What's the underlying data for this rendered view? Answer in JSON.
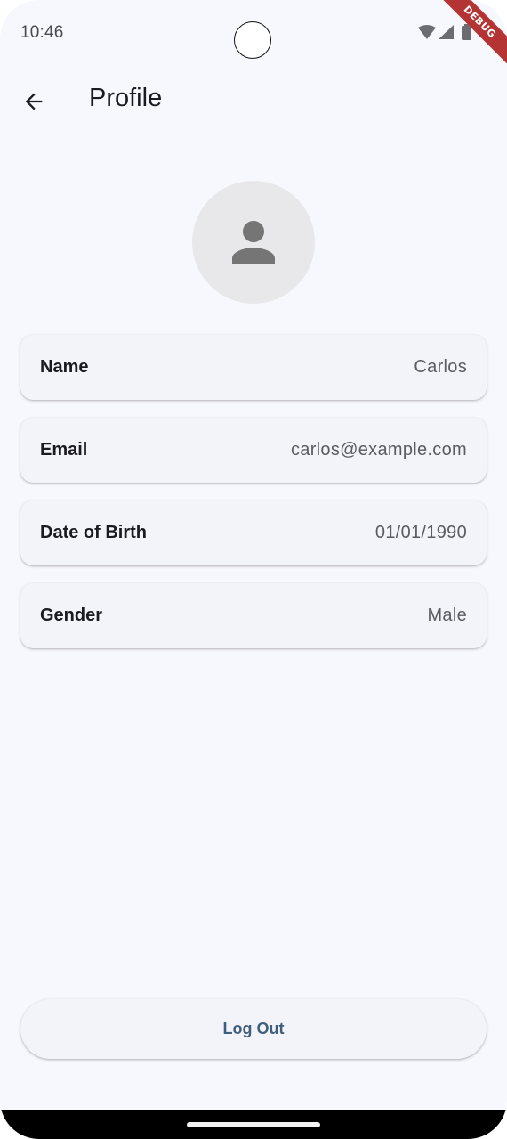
{
  "status_bar": {
    "time": "10:46",
    "icons": [
      "wifi-icon",
      "cellular-signal-icon",
      "battery-icon"
    ]
  },
  "debug_banner": {
    "label": "DEBUG",
    "color": "#b43434"
  },
  "app_bar": {
    "back_icon": "arrow-back-icon",
    "title": "Profile"
  },
  "avatar": {
    "icon": "person-icon"
  },
  "profile_fields": [
    {
      "label": "Name",
      "value": "Carlos"
    },
    {
      "label": "Email",
      "value": "carlos@example.com"
    },
    {
      "label": "Date of Birth",
      "value": "01/01/1990"
    },
    {
      "label": "Gender",
      "value": "Male"
    }
  ],
  "logout": {
    "label": "Log Out",
    "color": "#3f5f7c"
  },
  "colors": {
    "background": "#f7f8fd",
    "card": "#f3f3fa",
    "avatar_bg": "#e8e8ea",
    "avatar_icon": "#757575"
  }
}
